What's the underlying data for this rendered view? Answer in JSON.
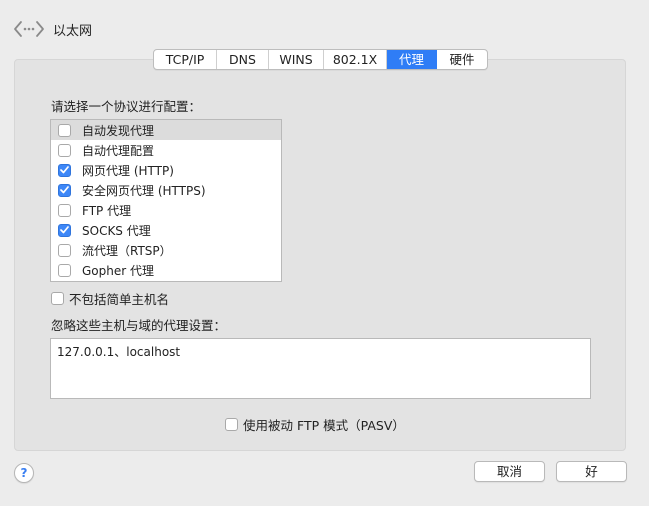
{
  "header": {
    "title": "以太网",
    "back_icon": "back-forward-icon"
  },
  "tabs": [
    {
      "label": "TCP/IP",
      "active": false
    },
    {
      "label": "DNS",
      "active": false
    },
    {
      "label": "WINS",
      "active": false
    },
    {
      "label": "802.1X",
      "active": false
    },
    {
      "label": "代理",
      "active": true
    },
    {
      "label": "硬件",
      "active": false
    }
  ],
  "protocols": {
    "label": "请选择一个协议进行配置：",
    "items": [
      {
        "label": "自动发现代理",
        "checked": false,
        "selected": true
      },
      {
        "label": "自动代理配置",
        "checked": false,
        "selected": false
      },
      {
        "label": "网页代理 (HTTP)",
        "checked": true,
        "selected": false
      },
      {
        "label": "安全网页代理 (HTTPS)",
        "checked": true,
        "selected": false
      },
      {
        "label": "FTP 代理",
        "checked": false,
        "selected": false
      },
      {
        "label": "SOCKS 代理",
        "checked": true,
        "selected": false
      },
      {
        "label": "流代理（RTSP）",
        "checked": false,
        "selected": false
      },
      {
        "label": "Gopher 代理",
        "checked": false,
        "selected": false
      }
    ]
  },
  "exclude_simple": {
    "label": "不包括简单主机名",
    "checked": false
  },
  "bypass": {
    "label": "忽略这些主机与域的代理设置：",
    "value": "127.0.0.1、localhost"
  },
  "passive_ftp": {
    "label": "使用被动 FTP 模式（PASV）",
    "checked": false
  },
  "buttons": {
    "help": "?",
    "cancel": "取消",
    "ok": "好"
  },
  "colors": {
    "accent": "#2f7df6",
    "background": "#ececec",
    "panel": "#e3e3e3"
  }
}
